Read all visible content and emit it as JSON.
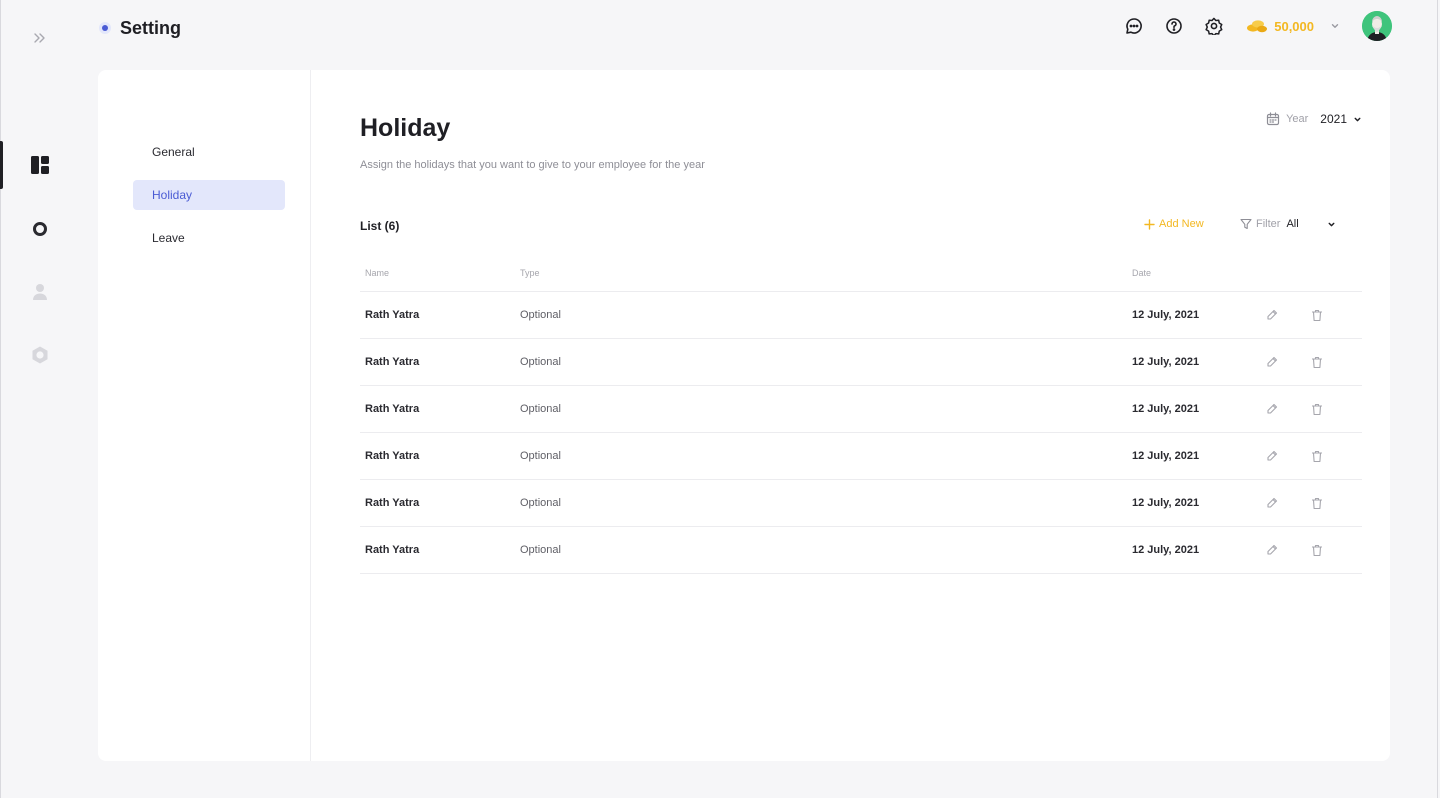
{
  "header": {
    "title": "Setting",
    "coins": "50,000",
    "icons": [
      "chat-icon",
      "help-icon",
      "settings-icon",
      "coins-icon",
      "chevron-down-icon"
    ]
  },
  "rail": {
    "items": [
      "dashboard-icon",
      "ring-icon",
      "user-icon",
      "hexagon-icon"
    ],
    "active": "dashboard-icon"
  },
  "subnav": {
    "items": [
      {
        "label": "General"
      },
      {
        "label": "Holiday"
      },
      {
        "label": "Leave"
      }
    ],
    "active": "Holiday"
  },
  "main": {
    "title": "Holiday",
    "subtitle": "Assign the holidays that you want to give to your employee for the year",
    "year_label": "Year",
    "year_value": "2021",
    "list_title": "List (6)",
    "add_new": "Add New",
    "filter_label": "Filter",
    "filter_value": "All"
  },
  "table": {
    "columns": {
      "name": "Name",
      "type": "Type",
      "date": "Date"
    },
    "rows": [
      {
        "name": "Rath Yatra",
        "type": "Optional",
        "date": "12 July, 2021"
      },
      {
        "name": "Rath Yatra",
        "type": "Optional",
        "date": "12 July, 2021"
      },
      {
        "name": "Rath Yatra",
        "type": "Optional",
        "date": "12 July, 2021"
      },
      {
        "name": "Rath Yatra",
        "type": "Optional",
        "date": "12 July, 2021"
      },
      {
        "name": "Rath Yatra",
        "type": "Optional",
        "date": "12 July, 2021"
      },
      {
        "name": "Rath Yatra",
        "type": "Optional",
        "date": "12 July, 2021"
      }
    ]
  },
  "colors": {
    "accent": "#4a5bd4",
    "active_bg": "#e3e7fb",
    "coins": "#f3b822",
    "avatar_bg": "#3fc47c",
    "page_bg": "#f6f6f8"
  }
}
